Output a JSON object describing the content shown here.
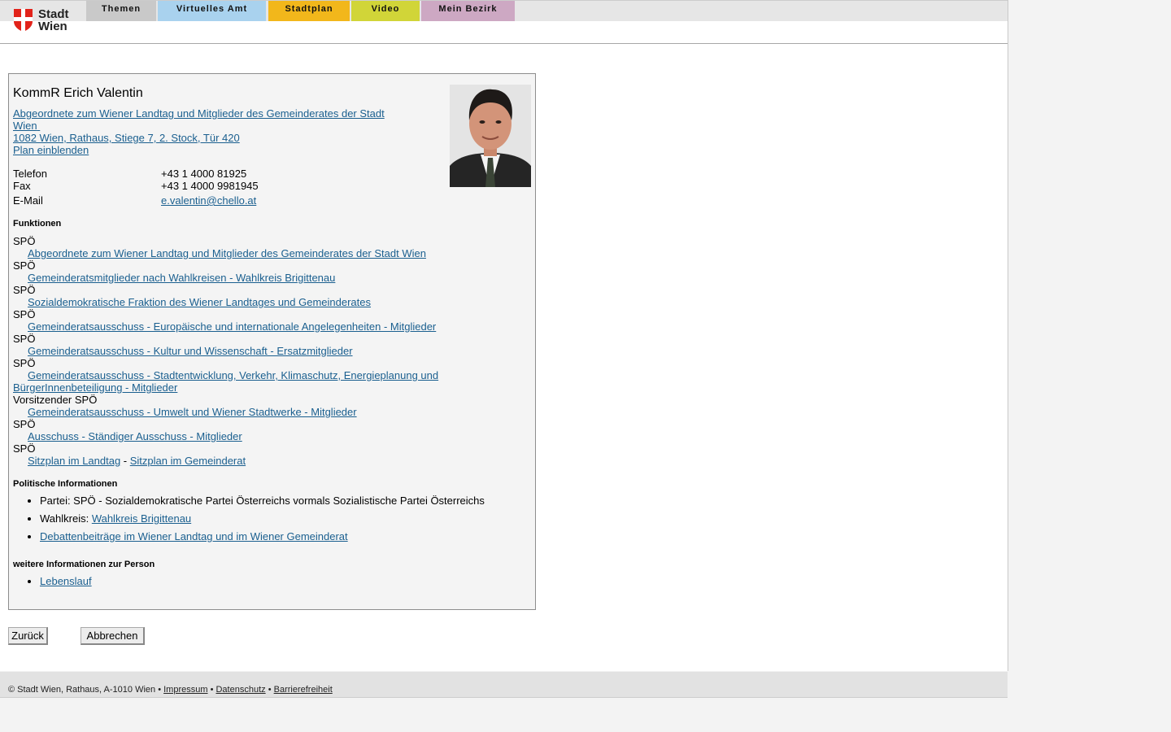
{
  "header": {
    "logo_text_line1": "Stadt",
    "logo_text_line2": "Wien",
    "nav": [
      {
        "label": "Themen",
        "color": "#c9c9c9"
      },
      {
        "label": "Virtuelles Amt",
        "color": "#a9d2ee"
      },
      {
        "label": "Stadtplan",
        "color": "#f2b71b"
      },
      {
        "label": "Video",
        "color": "#d1d538"
      },
      {
        "label": "Mein Bezirk",
        "color": "#cda8c3"
      }
    ]
  },
  "person": {
    "name": "KommR Erich Valentin",
    "role_link_line1": "Abgeordnete zum Wiener Landtag und Mitglieder des Gemeinderates der Stadt",
    "role_link_line2": "Wien",
    "address_link": "1082 Wien, Rathaus, Stiege 7, 2. Stock, Tür 420",
    "plan_link": "Plan einblenden",
    "contacts": {
      "phone_label": "Telefon",
      "phone_value": "+43 1 4000 81925",
      "fax_label": "Fax",
      "fax_value": "+43 1 4000 9981945",
      "email_label": "E-Mail",
      "email_value": "e.valentin@chello.at"
    }
  },
  "functions": {
    "heading": "Funktionen",
    "items": [
      {
        "party": "SPÖ",
        "link": "Abgeordnete zum Wiener Landtag und Mitglieder des Gemeinderates der Stadt Wien"
      },
      {
        "party": "SPÖ",
        "link": "Gemeinderatsmitglieder nach Wahlkreisen - Wahlkreis Brigittenau"
      },
      {
        "party": "SPÖ",
        "link": "Sozialdemokratische Fraktion des Wiener Landtages und Gemeinderates"
      },
      {
        "party": "SPÖ",
        "link": "Gemeinderatsausschuss - Europäische und internationale Angelegenheiten - Mitglieder"
      },
      {
        "party": "SPÖ",
        "link": "Gemeinderatsausschuss - Kultur und Wissenschaft - Ersatzmitglieder"
      },
      {
        "party": "SPÖ",
        "link": "Gemeinderatsausschuss - Stadtentwicklung, Verkehr, Klimaschutz, Energieplanung und BürgerInnenbeteiligung - Mitglieder"
      },
      {
        "party": "Vorsitzender SPÖ",
        "link": "Gemeinderatsausschuss - Umwelt und Wiener Stadtwerke - Mitglieder"
      },
      {
        "party": "SPÖ",
        "link": "Ausschuss - Ständiger Ausschuss - Mitglieder"
      }
    ],
    "last_party": "SPÖ",
    "seat_landtag": "Sitzplan im Landtag",
    "seat_separator": " - ",
    "seat_gemeinderat": "Sitzplan im Gemeinderat"
  },
  "political": {
    "heading": "Politische Informationen",
    "party_text": "Partei: SPÖ - Sozialdemokratische Partei Österreichs vormals Sozialistische Partei Österreichs",
    "wahlkreis_label": "Wahlkreis: ",
    "wahlkreis_link": "Wahlkreis Brigittenau",
    "debate_link": "Debattenbeiträge im Wiener Landtag und im Wiener Gemeinderat"
  },
  "more": {
    "heading": "weitere Informationen zur Person",
    "cv_link": "Lebenslauf"
  },
  "buttons": {
    "back": "Zurück",
    "cancel": "Abbrechen"
  },
  "footer": {
    "copyright": "© Stadt Wien, Rathaus, A-1010 Wien • ",
    "impressum": "Impressum",
    "sep1": " • ",
    "datenschutz": "Datenschutz",
    "sep2": " • ",
    "barrierefreiheit": "Barrierefreiheit"
  }
}
